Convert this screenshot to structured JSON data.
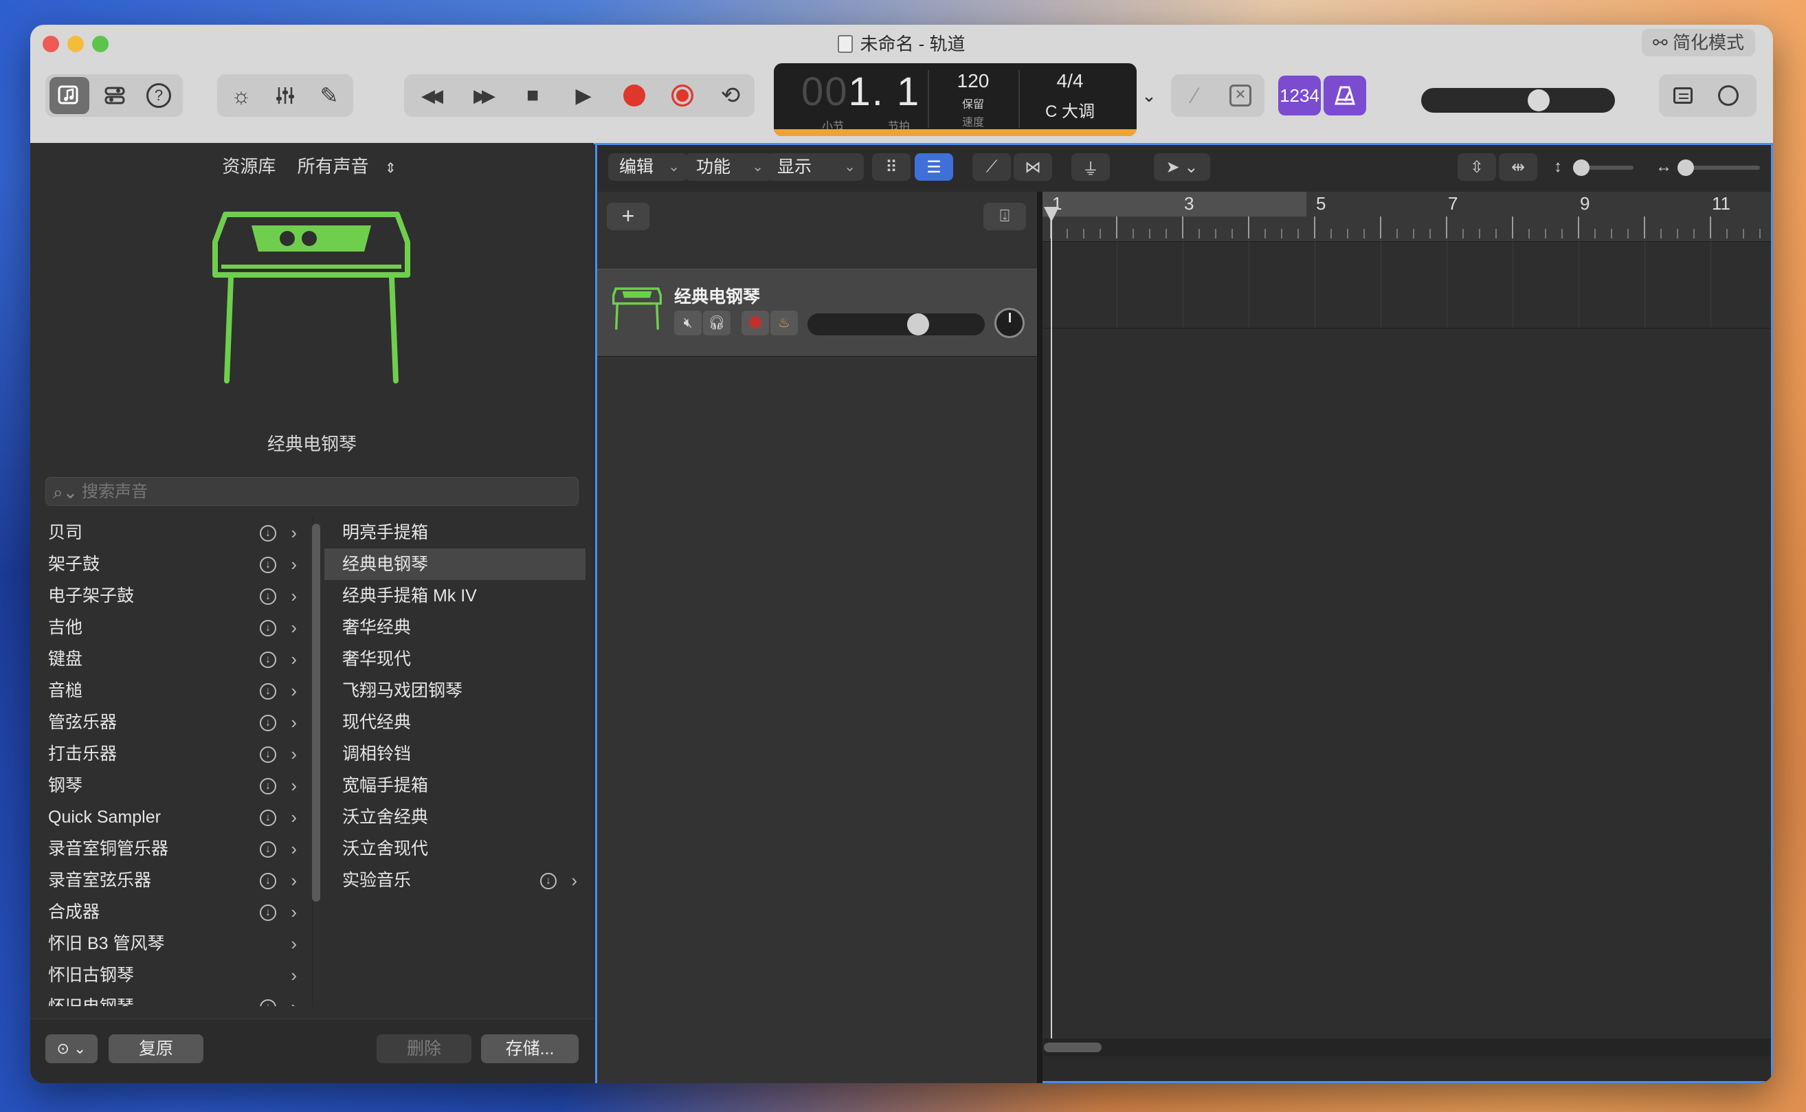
{
  "window": {
    "title": "未命名 - 轨道",
    "simple_mode_label": "简化模式",
    "traffic_colors": [
      "#ee5b52",
      "#f5bc3c",
      "#5ec449"
    ]
  },
  "toolbar": {
    "library_icon": "library-icon",
    "smart_controls_icon": "smart-controls-icon",
    "help_label": "?",
    "brightness_icon": "sun-icon",
    "mixer_icon": "mixer-icon",
    "editors_icon": "pencil-icon",
    "rewind": "◀◀",
    "forward": "▶▶",
    "stop": "■",
    "play": "▶",
    "cycle": "⟲"
  },
  "lcd": {
    "bars_prefix": "00",
    "position": "1. 1",
    "bar_label": "小节",
    "beat_label": "节拍",
    "tempo": "120",
    "keep_label": "保留",
    "tempo_label": "速度",
    "time_signature": "4/4",
    "key": "C 大调",
    "progress_color": "#f0a335"
  },
  "count_in_label": "1234",
  "metronome_icon": "metronome-icon",
  "master_volume_fraction": 0.62,
  "library": {
    "header_label": "资源库",
    "filter_label": "所有声音",
    "filter_chevron": "⌃",
    "preview_name": "经典电钢琴",
    "search_placeholder": "搜索声音",
    "categories": [
      {
        "label": "贝司",
        "download": true
      },
      {
        "label": "架子鼓",
        "download": true
      },
      {
        "label": "电子架子鼓",
        "download": true
      },
      {
        "label": "吉他",
        "download": true
      },
      {
        "label": "键盘",
        "download": true
      },
      {
        "label": "音槌",
        "download": true
      },
      {
        "label": "管弦乐器",
        "download": true
      },
      {
        "label": "打击乐器",
        "download": true
      },
      {
        "label": "钢琴",
        "download": true
      },
      {
        "label": "Quick Sampler",
        "download": true
      },
      {
        "label": "录音室铜管乐器",
        "download": true
      },
      {
        "label": "录音室弦乐器",
        "download": true
      },
      {
        "label": "合成器",
        "download": true
      },
      {
        "label": "怀旧 B3 管风琴",
        "download": false
      },
      {
        "label": "怀旧古钢琴",
        "download": false
      },
      {
        "label": "怀旧电钢琴",
        "download": true
      }
    ],
    "patches": [
      {
        "label": "明亮手提箱",
        "sub": false
      },
      {
        "label": "经典电钢琴",
        "sub": false
      },
      {
        "label": "经典手提箱 Mk IV",
        "sub": false
      },
      {
        "label": "奢华经典",
        "sub": false
      },
      {
        "label": "奢华现代",
        "sub": false
      },
      {
        "label": "飞翔马戏团钢琴",
        "sub": false
      },
      {
        "label": "现代经典",
        "sub": false
      },
      {
        "label": "调相铃铛",
        "sub": false
      },
      {
        "label": "宽幅手提箱",
        "sub": false
      },
      {
        "label": "沃立舍经典",
        "sub": false
      },
      {
        "label": "沃立舍现代",
        "sub": false
      },
      {
        "label": "实验音乐",
        "sub": true
      }
    ],
    "footer": {
      "more_icon": "ellipsis-circle-icon",
      "revert_label": "复原",
      "delete_label": "删除",
      "save_label": "存储..."
    },
    "instrument_color": "#6fcf4d"
  },
  "tracks_area": {
    "menus": [
      "编辑",
      "功能",
      "显示"
    ],
    "add_label": "+",
    "track": {
      "name": "经典电钢琴",
      "volume_fraction": 0.64
    },
    "ruler_numbers": [
      "1",
      "3",
      "5",
      "7",
      "9",
      "11"
    ],
    "accent_color": "#4a8ef0"
  }
}
